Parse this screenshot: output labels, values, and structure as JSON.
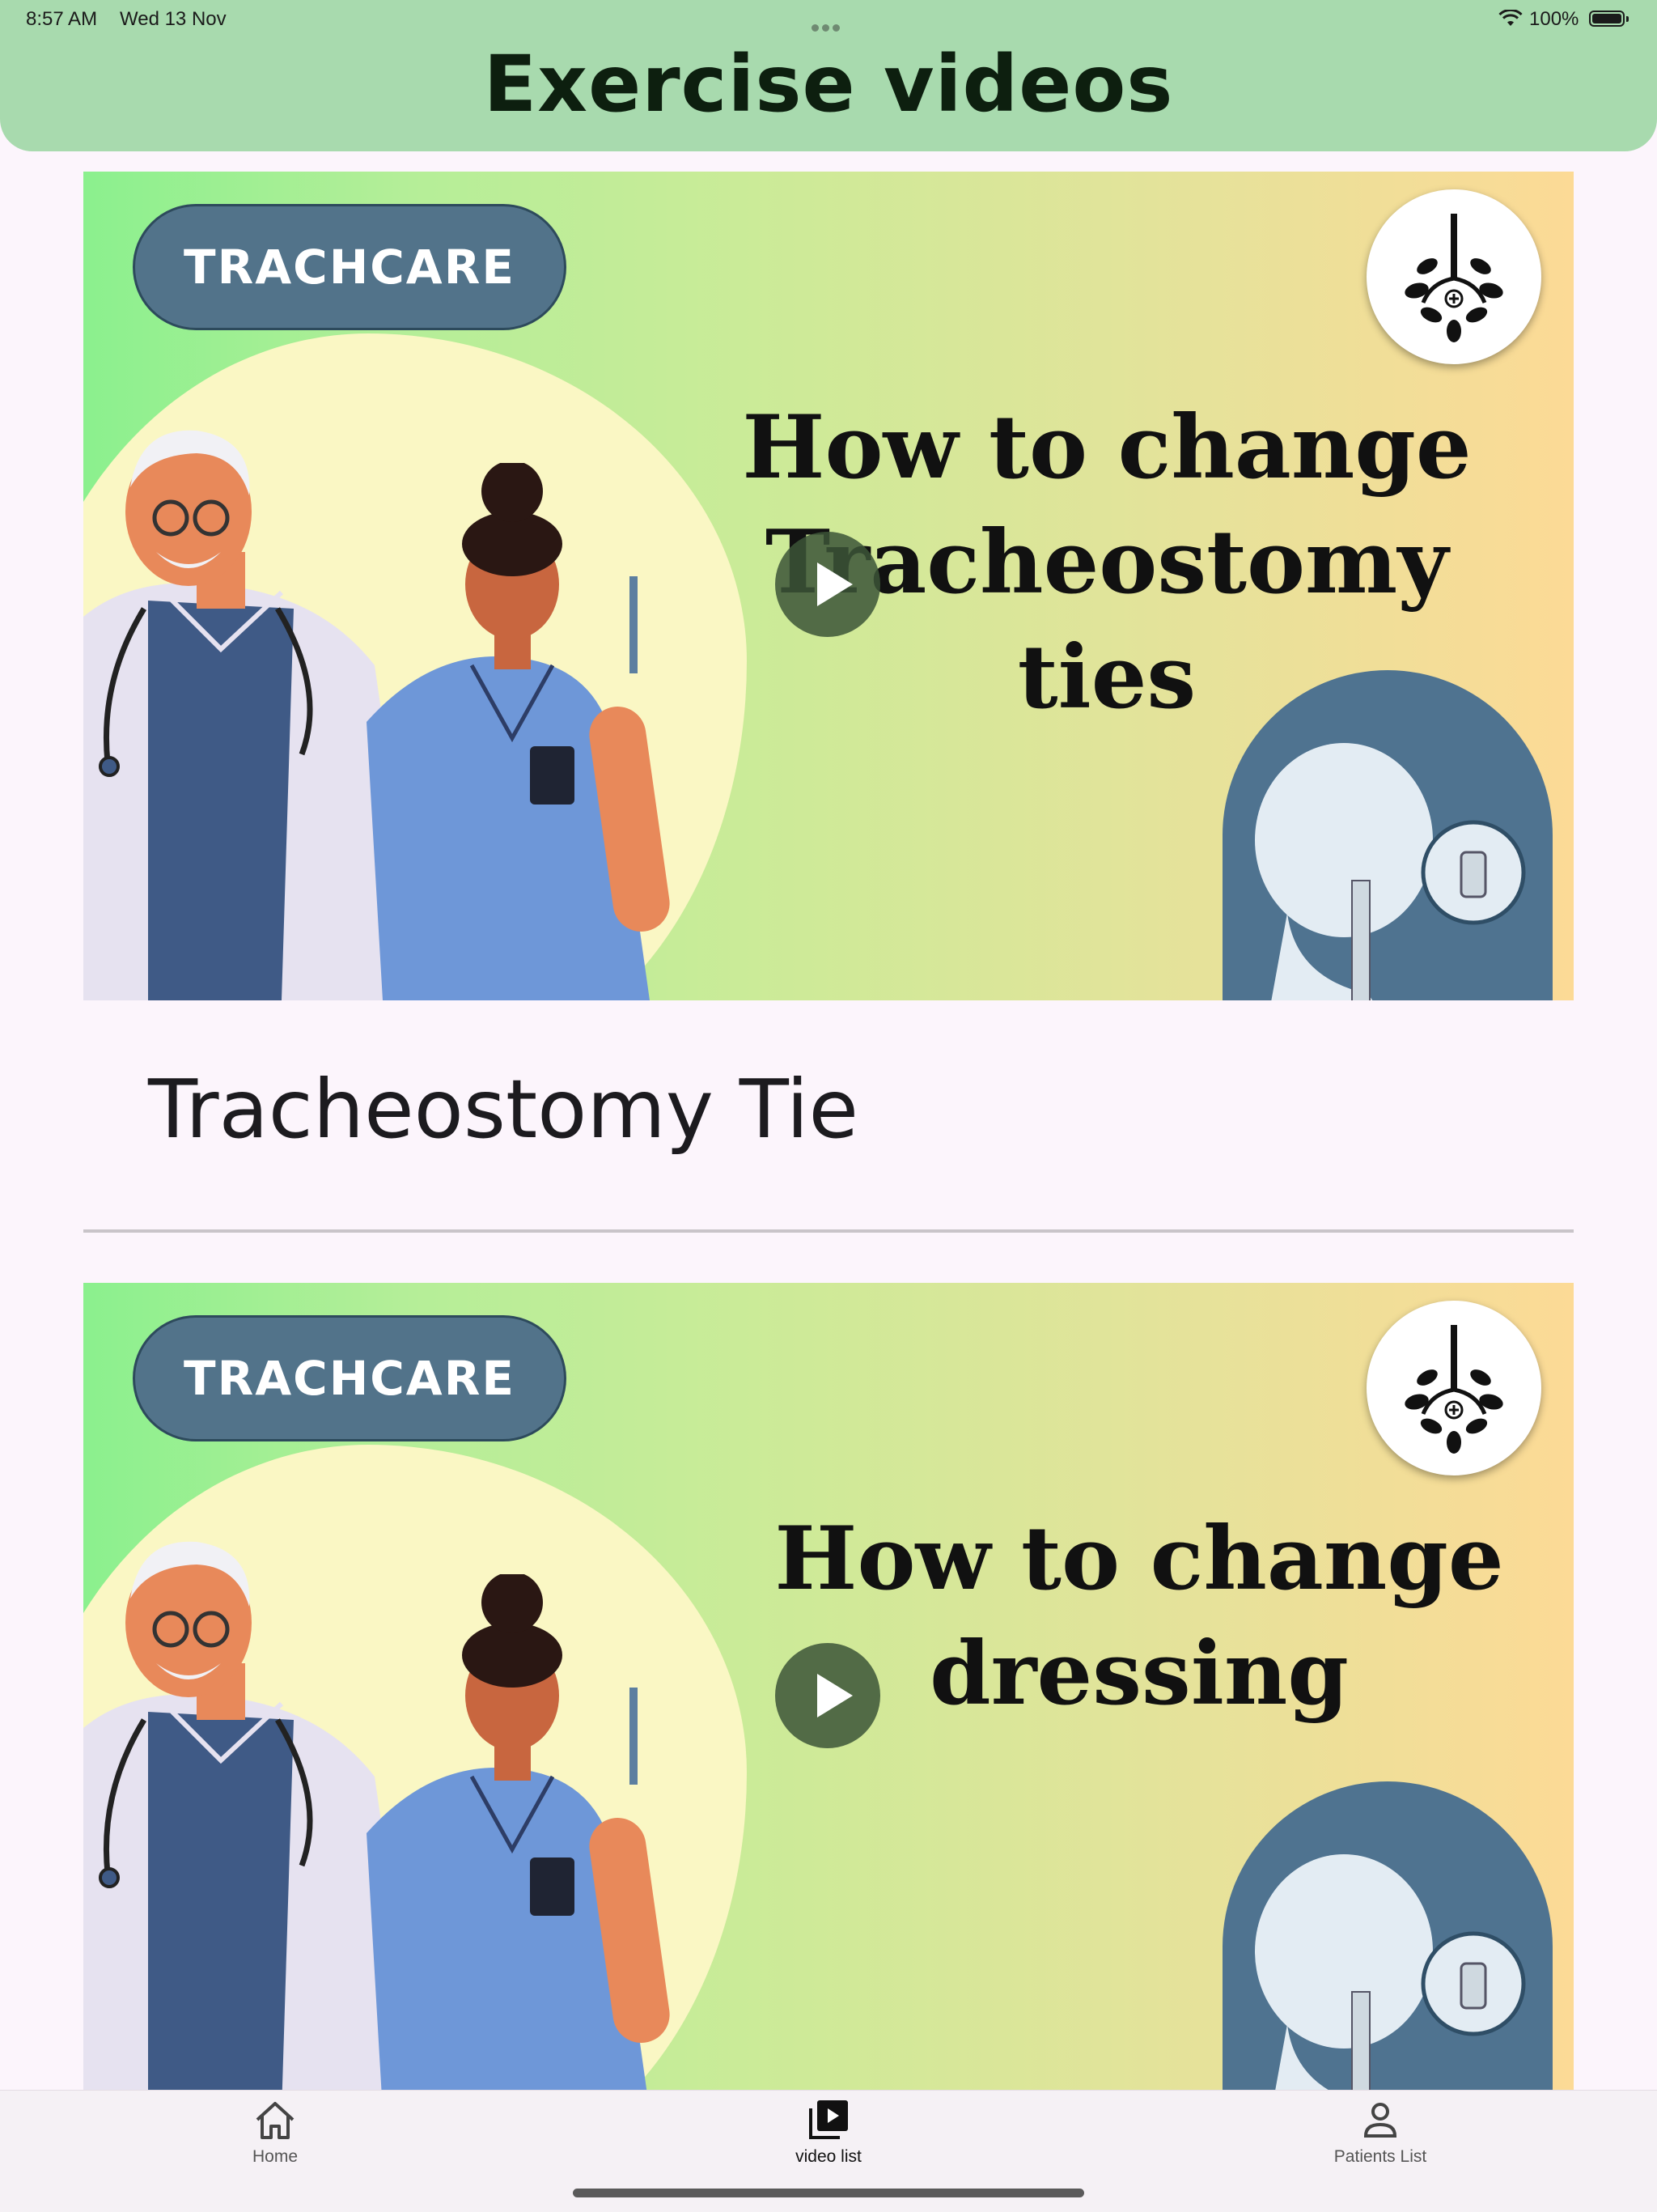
{
  "status_bar": {
    "time": "8:57 AM",
    "date": "Wed 13 Nov",
    "battery": "100%"
  },
  "header": {
    "title": "Exercise videos"
  },
  "videos": [
    {
      "brand": "TRACHCARE",
      "heading_line1": "How to change",
      "heading_line2": "Tracheostomy ties",
      "title": "Tracheostomy Tie"
    },
    {
      "brand": "TRACHCARE",
      "heading_line1": "How to change",
      "heading_line2": "dressing",
      "title": ""
    }
  ],
  "tabbar": {
    "items": [
      {
        "label": "Home",
        "icon": "home-icon"
      },
      {
        "label": "video list",
        "icon": "video-list-icon"
      },
      {
        "label": "Patients List",
        "icon": "person-icon"
      }
    ],
    "active": "video list"
  },
  "colors": {
    "header": "#A8DAAE",
    "background": "#FCF5FC",
    "brand_pill": "#52738A"
  }
}
